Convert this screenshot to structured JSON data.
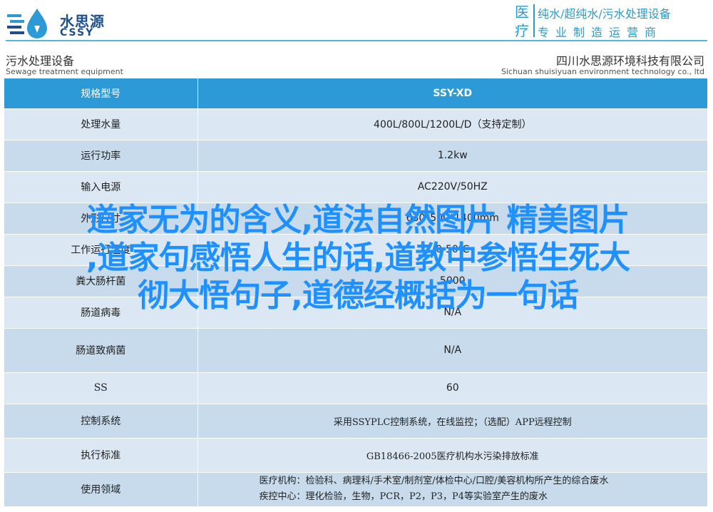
{
  "brand": {
    "name_cn": "水思源",
    "name_en": "CSSY",
    "slogan_left": "医疗",
    "slogan_top": "纯水/超纯水/污水处理设备",
    "slogan_bottom": "专业制造运营商"
  },
  "subheader": {
    "left_cn": "污水处理设备",
    "left_en": "Sewage treatment equipment",
    "right_cn": "四川水思源环境科技有限公司",
    "right_en": "Sichuan shuisiyuan environment technology co., ltd"
  },
  "table": {
    "header": {
      "label": "规格型号",
      "value": "SSY-XD"
    },
    "rows": [
      {
        "label": "处理水量",
        "value": "400L/800L/1200L/D（支持定制）"
      },
      {
        "label": "运行功率",
        "value": "1.2kw"
      },
      {
        "label": "输入电源",
        "value": "AC220V/50HZ"
      },
      {
        "label": "外形尺寸",
        "value": "630*500*1400mm"
      },
      {
        "label": "工作运行温度",
        "value": "0-50℃"
      },
      {
        "label": "粪大肠杆菌",
        "value": "5000"
      },
      {
        "label": "肠道病毒",
        "value": "N/A"
      },
      {
        "label": "肠道致病菌",
        "value": "N/A"
      },
      {
        "label": "SS",
        "value": "60"
      },
      {
        "label": "控制系统",
        "value": "采用SSYPLC控制系统，在线监控；（选配）APP远程控制"
      },
      {
        "label": "执行标准",
        "value": "GB18466-2005医疗机构水污染排放标准"
      },
      {
        "label": "使用领域",
        "value_line1": "医疗机构：检验科、病理科/手术室/制剂室/体检中心/口腔/美容机构所产生的综合废水",
        "value_line2": "疾控中心：理化检验，生物，PCR，P2，P3，P4等实验室产生的废水"
      }
    ]
  },
  "overlay": {
    "line1": "道家无为的含义,道法自然图片 精美图片",
    "line2": ",道家句感悟人生的话,道教中参悟生死大",
    "line3": "彻大悟句子,道德经概括为一句话"
  },
  "colors": {
    "header_blue": "#2b9ad6",
    "row_light": "#dbe8f3",
    "row_dark": "#c7dbec",
    "overlay_blue": "#1e90ff",
    "brand_navy": "#1d4f8c"
  }
}
